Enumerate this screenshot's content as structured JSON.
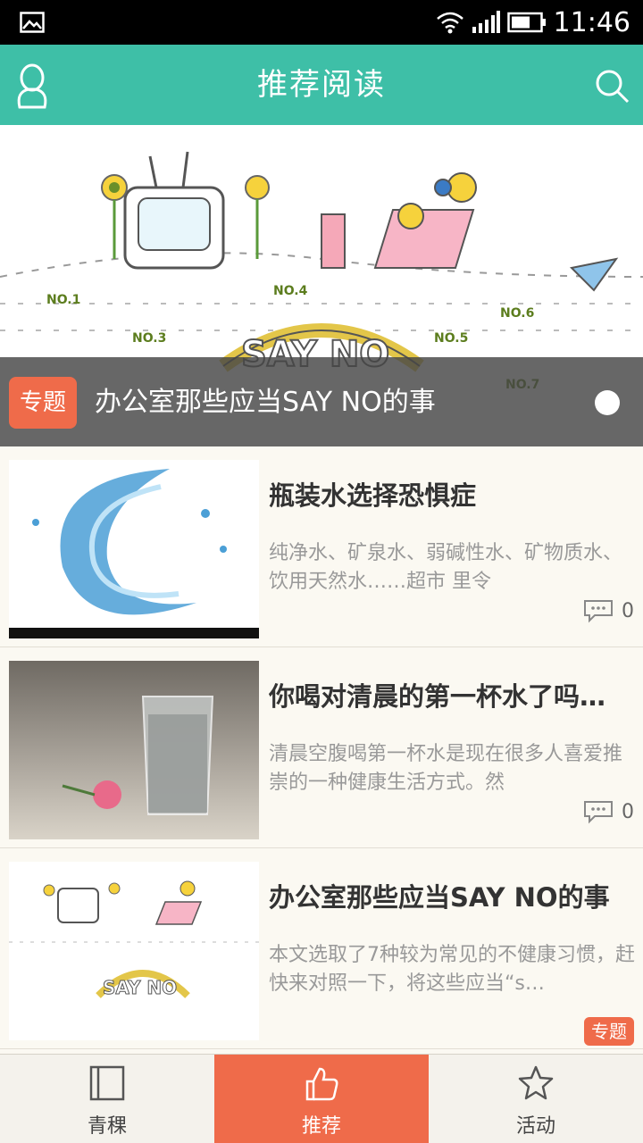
{
  "status_bar": {
    "time": "11:46",
    "icons": [
      "gallery-icon",
      "wifi-icon",
      "signal-icon",
      "battery-icon"
    ]
  },
  "app_bar": {
    "title": "推荐阅读",
    "left_icon": "user-icon",
    "right_icon": "search-icon"
  },
  "banner": {
    "tag": "专题",
    "title": "办公室那些应当SAY NO的事"
  },
  "articles": [
    {
      "title": "瓶装水选择恐惧症",
      "desc": "纯净水、矿泉水、弱碱性水、矿物质水、饮用天然水……超市 里令",
      "comments": "0",
      "tag": ""
    },
    {
      "title": "你喝对清晨的第一杯水了吗…",
      "desc": "清晨空腹喝第一杯水是现在很多人喜爱推崇的一种健康生活方式。然",
      "comments": "0",
      "tag": ""
    },
    {
      "title": "办公室那些应当SAY NO的事",
      "desc": "本文选取了7种较为常见的不健康习惯，赶快来对照一下，将这些应当“s…",
      "comments": "",
      "tag": "专题"
    }
  ],
  "bottom_nav": [
    {
      "label": "青稞",
      "icon": "book-icon",
      "active": false
    },
    {
      "label": "推荐",
      "icon": "thumbs-up-icon",
      "active": true
    },
    {
      "label": "活动",
      "icon": "star-icon",
      "active": false
    }
  ],
  "colors": {
    "accent": "#3ebfa7",
    "highlight": "#ef6b4a",
    "background": "#fbf9f2"
  }
}
